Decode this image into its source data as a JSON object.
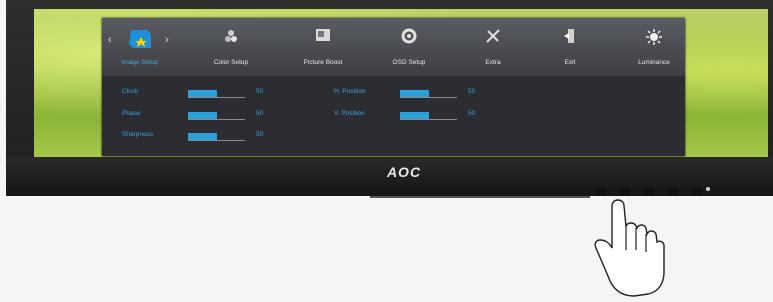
{
  "brand": "AOC",
  "colors": {
    "accent": "#2a9fd9",
    "label": "#3aa3d8",
    "osd_bg": "#2b2d33"
  },
  "osd": {
    "tabs": [
      {
        "label": "Image Setup",
        "icon": "image-setup-icon",
        "active": true
      },
      {
        "label": "Color Setup",
        "icon": "color-setup-icon",
        "active": false
      },
      {
        "label": "Picture Boost",
        "icon": "picture-boost-icon",
        "active": false
      },
      {
        "label": "OSD Setup",
        "icon": "osd-setup-icon",
        "active": false
      },
      {
        "label": "Extra",
        "icon": "extra-icon",
        "active": false
      },
      {
        "label": "Exit",
        "icon": "exit-icon",
        "active": false
      },
      {
        "label": "Luminance",
        "icon": "luminance-icon",
        "active": false
      }
    ],
    "left_settings": [
      {
        "label": "Clock",
        "value": "50",
        "level": 0.5
      },
      {
        "label": "Phase",
        "value": "50",
        "level": 0.5
      },
      {
        "label": "Sharpness",
        "value": "50",
        "level": 0.5
      }
    ],
    "right_settings": [
      {
        "label": "H. Position",
        "value": "50",
        "level": 0.5
      },
      {
        "label": "V. Position",
        "value": "50",
        "level": 0.5
      }
    ]
  }
}
